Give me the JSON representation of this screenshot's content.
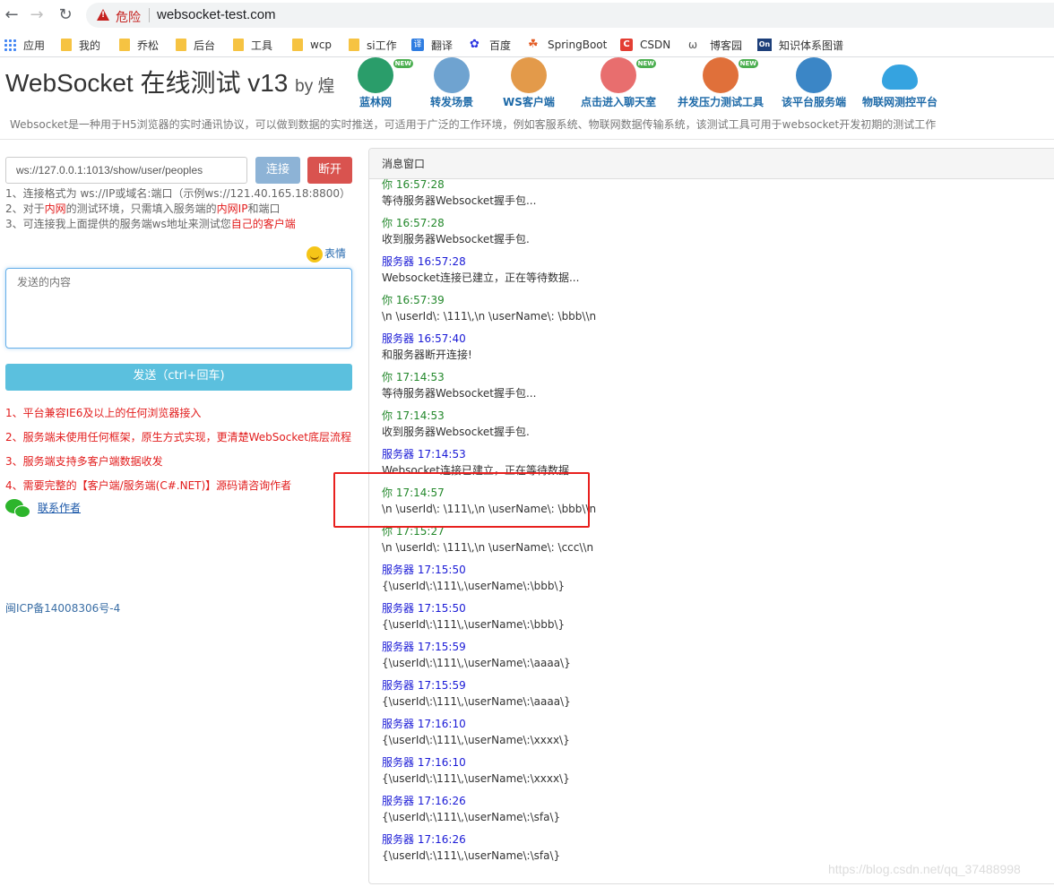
{
  "browser": {
    "security_label": "危险",
    "url": "websocket-test.com",
    "bookmarks": [
      "应用",
      "我的",
      "乔松",
      "后台",
      "工具",
      "wcp",
      "si工作",
      "翻译",
      "百度",
      "SpringBoot",
      "CSDN",
      "博客园",
      "知识体系图谱"
    ]
  },
  "header": {
    "title": "WebSocket 在线测试 v13",
    "by": "by 煌",
    "description": "Websocket是一种用于H5浏览器的实时通讯协议，可以做到数据的实时推送，可适用于广泛的工作环境，例如客服系统、物联网数据传输系统，该测试工具可用于websocket开发初期的测试工作",
    "nav": [
      {
        "label": "蓝林网",
        "icon": "globe-icon",
        "new": "NEW",
        "color": "#2a9d6a"
      },
      {
        "label": "转发场景",
        "icon": "antenna-icon",
        "new": "",
        "color": "#6fa3d0"
      },
      {
        "label": "WS客户端",
        "icon": "speaker-icon",
        "new": "",
        "color": "#e39a4a"
      },
      {
        "label": "点击进入聊天室",
        "icon": "people-icon",
        "new": "NEW",
        "color": "#e86e6e"
      },
      {
        "label": "并发压力测试工具",
        "icon": "pencil-icon",
        "new": "NEW",
        "color": "#e0703a"
      },
      {
        "label": "该平台服务端",
        "icon": "earth-icon",
        "new": "",
        "color": "#3b86c6"
      },
      {
        "label": "物联网测控平台",
        "icon": "cloud-icon",
        "new": "",
        "color": "#35a3e0"
      }
    ]
  },
  "connect": {
    "url_value": "ws://127.0.0.1:1013/show/user/peoples",
    "connect_label": "连接",
    "disconnect_label": "断开",
    "tips": [
      [
        "1、连接格式为 ws://IP或域名:端口（示例ws://121.40.165.18:8800）"
      ],
      [
        "2、对于",
        "内网",
        "的测试环境，只需填入服务端的",
        "内网IP",
        "和端口"
      ],
      [
        "3、可连接我上面提供的服务端ws地址来测试您",
        "自己的客户端",
        ""
      ]
    ]
  },
  "composer": {
    "emoji_label": "表情",
    "placeholder": "发送的内容",
    "send_label": "发送（ctrl+回车)"
  },
  "features": [
    "1、平台兼容IE6及以上的任何浏览器接入",
    "2、服务端未使用任何框架，原生方式实现，更清楚WebSocket底层流程",
    "3、服务端支持多客户端数据收发",
    "4、需要完整的【客户端/服务端(C#.NET)】源码请咨询作者"
  ],
  "contact_label": "联系作者",
  "icp": "闽ICP备14008306号-4",
  "messages_panel": {
    "title": "消息窗口",
    "colors": {
      "you": "#23882b",
      "server": "#1a1ad6"
    },
    "messages": [
      {
        "who": "你 16:57:28",
        "kind": "you",
        "text": "等待服务器Websocket握手包..."
      },
      {
        "who": "你 16:57:28",
        "kind": "you",
        "text": "收到服务器Websocket握手包."
      },
      {
        "who": "服务器 16:57:28",
        "kind": "server",
        "text": "Websocket连接已建立，正在等待数据..."
      },
      {
        "who": "你 16:57:39",
        "kind": "you",
        "text": "\\n \\userId\\: \\111\\,\\n \\userName\\: \\bbb\\\\n"
      },
      {
        "who": "服务器 16:57:40",
        "kind": "server",
        "text": "和服务器断开连接!"
      },
      {
        "who": "你 17:14:53",
        "kind": "you",
        "text": "等待服务器Websocket握手包..."
      },
      {
        "who": "你 17:14:53",
        "kind": "you",
        "text": "收到服务器Websocket握手包."
      },
      {
        "who": "服务器 17:14:53",
        "kind": "server",
        "text": "Websocket连接已建立，正在等待数据..."
      },
      {
        "who": "你 17:14:57",
        "kind": "you",
        "text": "\\n \\userId\\: \\111\\,\\n \\userName\\: \\bbb\\\\n"
      },
      {
        "who": "你 17:15:27",
        "kind": "you",
        "text": "\\n \\userId\\: \\111\\,\\n \\userName\\: \\ccc\\\\n"
      },
      {
        "who": "服务器 17:15:50",
        "kind": "server",
        "text": "{\\userId\\:\\111\\,\\userName\\:\\bbb\\}"
      },
      {
        "who": "服务器 17:15:50",
        "kind": "server",
        "text": "{\\userId\\:\\111\\,\\userName\\:\\bbb\\}"
      },
      {
        "who": "服务器 17:15:59",
        "kind": "server",
        "text": "{\\userId\\:\\111\\,\\userName\\:\\aaaa\\}"
      },
      {
        "who": "服务器 17:15:59",
        "kind": "server",
        "text": "{\\userId\\:\\111\\,\\userName\\:\\aaaa\\}"
      },
      {
        "who": "服务器 17:16:10",
        "kind": "server",
        "text": "{\\userId\\:\\111\\,\\userName\\:\\xxxx\\}"
      },
      {
        "who": "服务器 17:16:10",
        "kind": "server",
        "text": "{\\userId\\:\\111\\,\\userName\\:\\xxxx\\}"
      },
      {
        "who": "服务器 17:16:26",
        "kind": "server",
        "text": "{\\userId\\:\\111\\,\\userName\\:\\sfa\\}"
      },
      {
        "who": "服务器 17:16:26",
        "kind": "server",
        "text": "{\\userId\\:\\111\\,\\userName\\:\\sfa\\}"
      }
    ]
  },
  "watermark": "https://blog.csdn.net/qq_37488998"
}
